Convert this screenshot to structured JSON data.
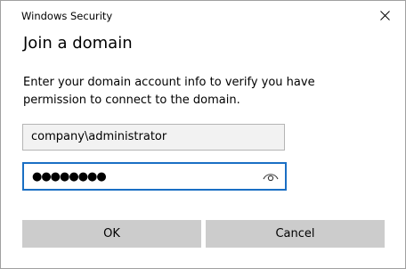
{
  "window": {
    "title": "Windows Security",
    "close_icon": "close-icon"
  },
  "dialog": {
    "heading": "Join a domain",
    "description": "Enter your domain account info to verify you have permission to connect to the domain."
  },
  "fields": {
    "username": {
      "value": "company\\administrator"
    },
    "password": {
      "masked_value": "●●●●●●●●",
      "reveal_icon": "eye-icon"
    }
  },
  "buttons": {
    "ok_label": "OK",
    "cancel_label": "Cancel"
  },
  "colors": {
    "focus_border": "#1a6fc4",
    "button_background": "#cccccc",
    "readonly_field_background": "#f2f2f2"
  }
}
